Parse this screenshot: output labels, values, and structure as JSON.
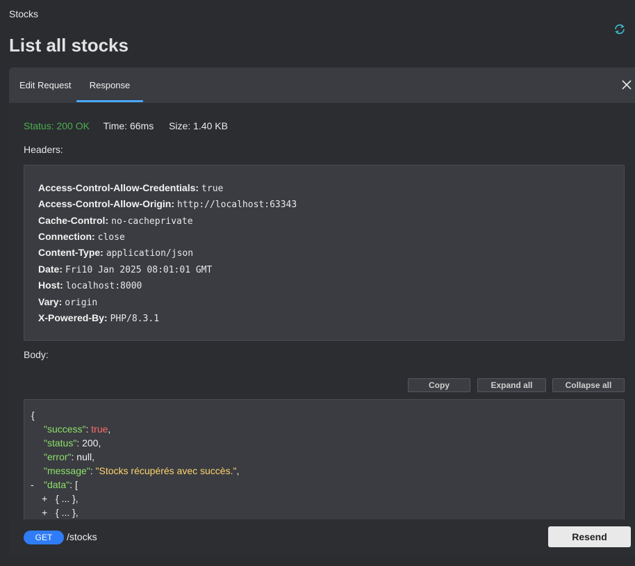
{
  "breadcrumb": "Stocks",
  "page_title": "List all stocks",
  "tabs": {
    "edit": "Edit Request",
    "response": "Response"
  },
  "response": {
    "status": "Status: 200 OK",
    "time": "Time: 66ms",
    "size": "Size: 1.40 KB"
  },
  "headers_label": "Headers:",
  "headers": [
    {
      "key": "Access-Control-Allow-Credentials:",
      "value": "true"
    },
    {
      "key": "Access-Control-Allow-Origin:",
      "value": "http://localhost:63343"
    },
    {
      "key": "Cache-Control:",
      "value": "no-cacheprivate"
    },
    {
      "key": "Connection:",
      "value": "close"
    },
    {
      "key": "Content-Type:",
      "value": "application/json"
    },
    {
      "key": "Date:",
      "value": "Fri10 Jan 2025 08:01:01 GMT"
    },
    {
      "key": "Host:",
      "value": "localhost:8000"
    },
    {
      "key": "Vary:",
      "value": "origin"
    },
    {
      "key": "X-Powered-By:",
      "value": "PHP/8.3.1"
    }
  ],
  "body_label": "Body:",
  "body_actions": {
    "copy": "Copy",
    "expand": "Expand all",
    "collapse": "Collapse all"
  },
  "json": {
    "open_brace": "{",
    "success_key": "\"success\"",
    "success_val": "true",
    "status_key": "\"status\"",
    "status_val": "200",
    "error_key": "\"error\"",
    "error_val": "null",
    "message_key": "\"message\"",
    "message_val": "\"Stocks récupérés avec succès.\"",
    "data_key": "\"data\"",
    "data_open": "[",
    "collapsed_item": "{ ... },",
    "minus": "-",
    "plus": "+"
  },
  "footer": {
    "method": "GET",
    "path": "/stocks",
    "resend": "Resend"
  },
  "colors": {
    "background": "#2a2c30",
    "tabbar": "#3a3c41",
    "accent": "#4aa8ff",
    "status_ok": "#4caf50",
    "json_key": "#8ee06a",
    "json_bool": "#ff6b6b",
    "json_string": "#ffd36e",
    "method_badge": "#2f7cf6",
    "refresh_icon": "#3fb6c6"
  }
}
